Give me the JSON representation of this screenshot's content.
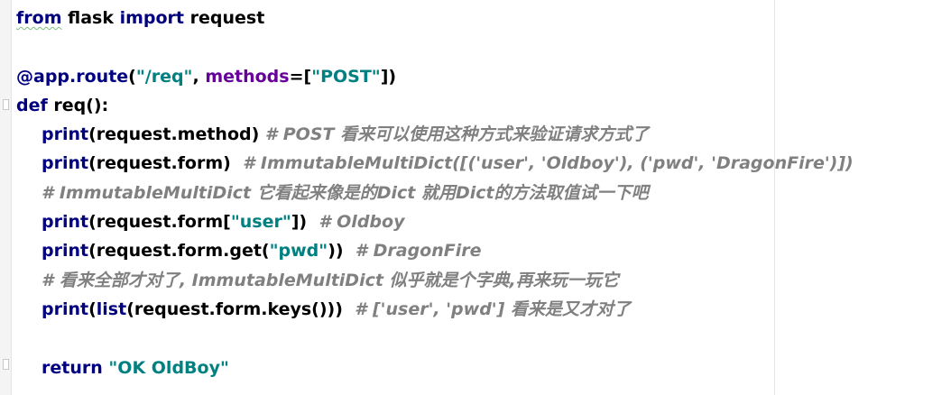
{
  "code": {
    "l1": {
      "kw_from": "from",
      "mod": " flask ",
      "kw_import": "import",
      "name": " request"
    },
    "l3": {
      "deco": "@app.route",
      "p1": "(",
      "route": "\"/req\"",
      "p2": ", ",
      "kwarg": "methods",
      "p3": "=[",
      "method": "\"POST\"",
      "p4": "])"
    },
    "l4": {
      "kw_def": "def",
      "rest": " req():"
    },
    "l5": {
      "fn": "print",
      "code": "(request.method)",
      "comment": " # POST 看来可以使用这种方式来验证请求方式了"
    },
    "l6": {
      "fn": "print",
      "code": "(request.form) ",
      "comment": " # ImmutableMultiDict([('user', 'Oldboy'), ('pwd', 'DragonFire')])"
    },
    "l7": {
      "comment": "# ImmutableMultiDict 它看起来像是的Dict 就用Dict的方法取值试一下吧"
    },
    "l8": {
      "fn": "print",
      "p1": "(request.form[",
      "key": "\"user\"",
      "p2": "]) ",
      "comment": " # Oldboy"
    },
    "l9": {
      "fn": "print",
      "p1": "(request.form.get(",
      "key": "\"pwd\"",
      "p2": ")) ",
      "comment": " # DragonFire"
    },
    "l10": {
      "comment": "# 看来全部才对了, ImmutableMultiDict 似乎就是个字典,再来玩一玩它"
    },
    "l11": {
      "fn": "print",
      "p1": "(",
      "fn2": "list",
      "p2": "(request.form.keys())) ",
      "comment": " # ['user', 'pwd'] 看来是又才对了"
    },
    "l13": {
      "kw_return": "return",
      "sp": " ",
      "str": "\"OK OldBoy\""
    }
  }
}
